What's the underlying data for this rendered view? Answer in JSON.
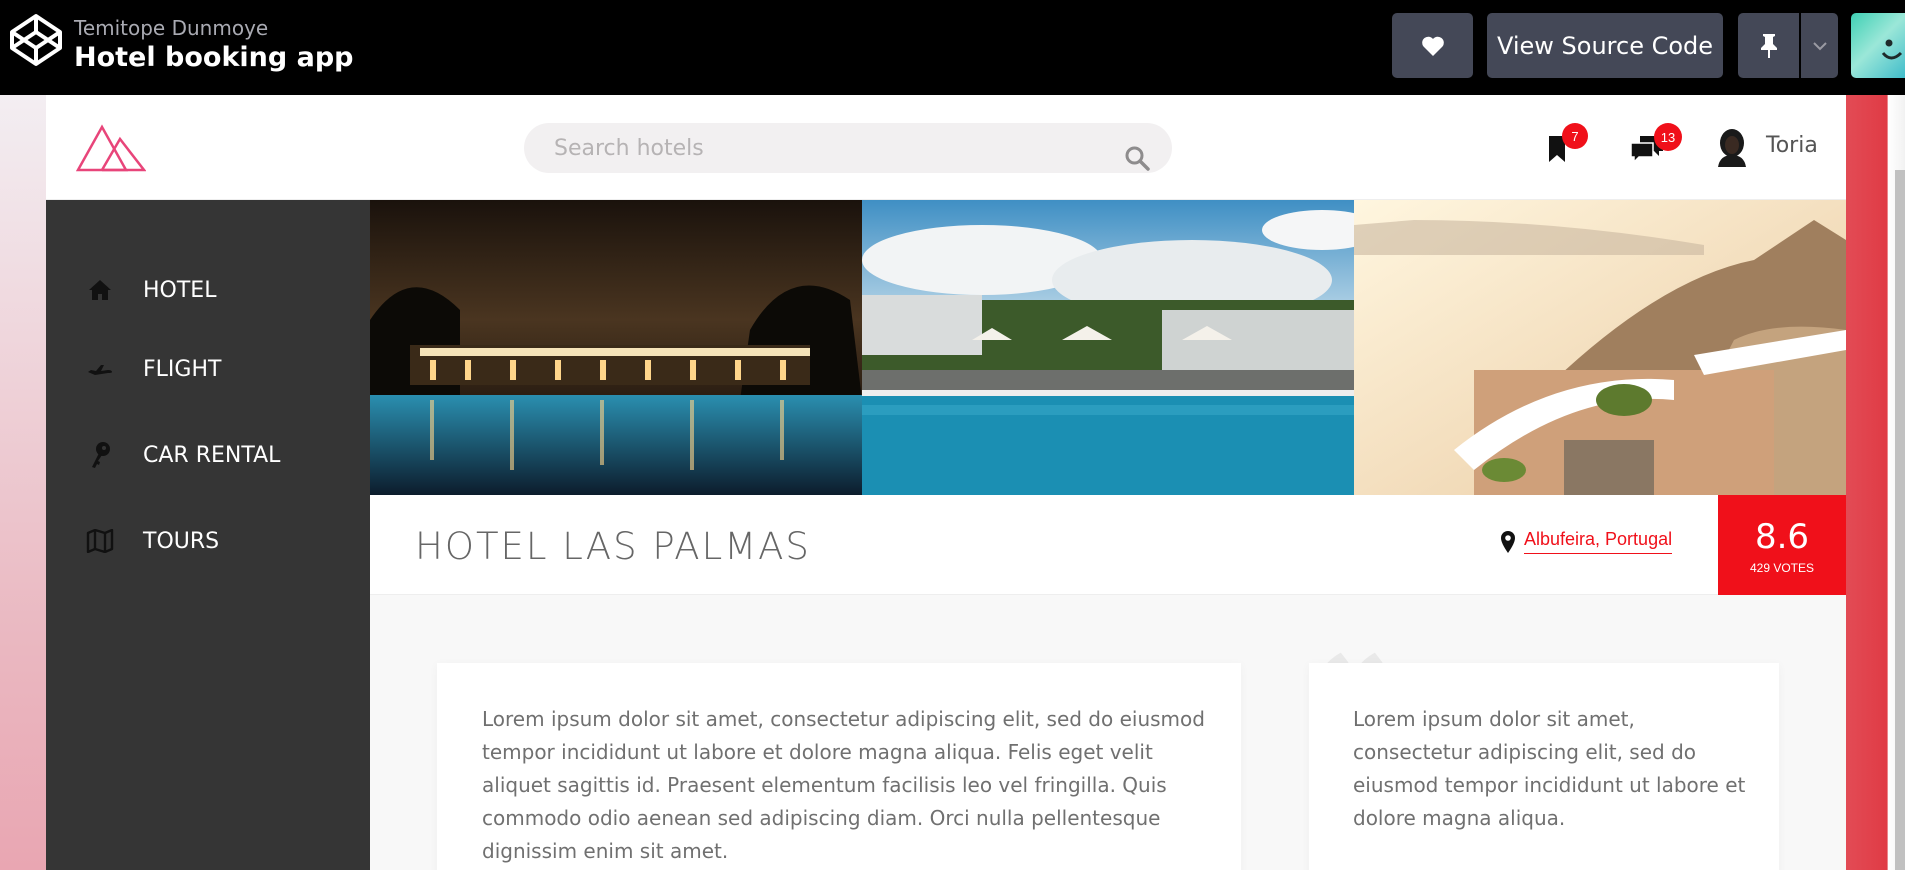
{
  "codepen": {
    "author": "Temitope Dunmoye",
    "title": "Hotel booking app",
    "view_source_label": "View Source Code"
  },
  "header": {
    "search_placeholder": "Search hotels",
    "bookmarks_count": "7",
    "messages_count": "13",
    "user_name": "Toria"
  },
  "sidebar": {
    "items": [
      {
        "label": "HOTEL",
        "icon": "home-icon"
      },
      {
        "label": "FLIGHT",
        "icon": "plane-icon"
      },
      {
        "label": "CAR RENTAL",
        "icon": "key-icon"
      },
      {
        "label": "TOURS",
        "icon": "map-icon"
      }
    ]
  },
  "hotel": {
    "name": "HOTEL LAS PALMAS",
    "location": "Albufeira, Portugal",
    "rating": "8.6",
    "votes": "429 VOTES"
  },
  "content": {
    "main_text": "Lorem ipsum dolor sit amet, consectetur adipiscing elit, sed do eiusmod tempor incididunt ut labore et dolore magna aliqua. Felis eget velit aliquet sagittis id. Praesent elementum facilisis leo vel fringilla. Quis commodo odio aenean sed adipiscing diam. Orci nulla pellentesque dignissim enim sit amet.",
    "quote_text": "Lorem ipsum dolor sit amet, consectetur adipiscing elit, sed do eiusmod tempor incididunt ut labore et dolore magna aliqua."
  },
  "colors": {
    "accent": "#f0101a",
    "sidebar_bg": "#353535",
    "codepen_bar": "#000000",
    "codepen_button": "#444857",
    "logo_pink": "#e8457a"
  }
}
